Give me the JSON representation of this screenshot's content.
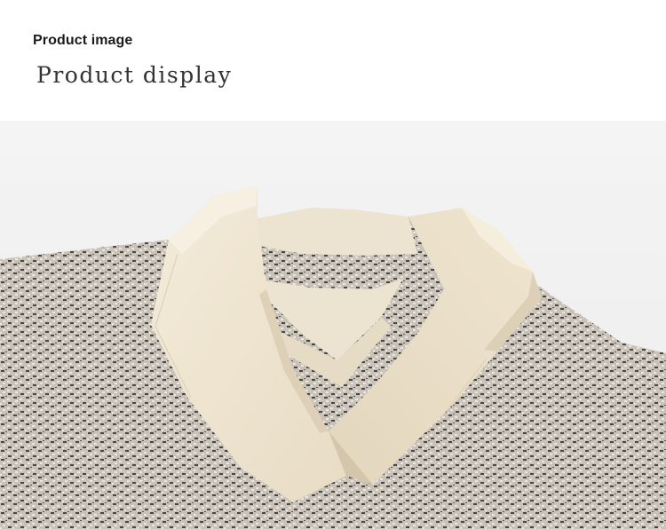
{
  "header": {
    "title": "Product image",
    "subtitle": "Product display"
  },
  "photo": {
    "subject": "sweater-collar-closeup",
    "colors": {
      "background": "#f2f2f2",
      "knit_base": "#c9c2b8",
      "knit_dark": "#4a4644",
      "knit_light": "#ece6dc",
      "lapel": "#efe6d2",
      "lapel_shadow": "#ddd2bb"
    }
  }
}
